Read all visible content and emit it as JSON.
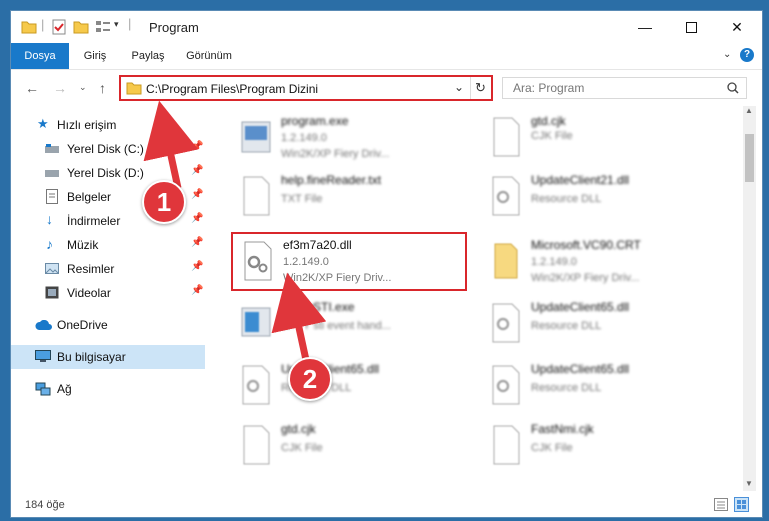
{
  "window": {
    "title": "Program"
  },
  "ribbon": {
    "tabs": [
      "Dosya",
      "Giriş",
      "Paylaş",
      "Görünüm"
    ]
  },
  "address": {
    "path": "C:\\Program Files\\Program Dizini"
  },
  "search": {
    "placeholder": "Ara: Program"
  },
  "sidebar": {
    "quick_access": "Hızlı erişim",
    "items": [
      {
        "label": "Yerel Disk (C:)"
      },
      {
        "label": "Yerel Disk (D:)"
      },
      {
        "label": "Belgeler"
      },
      {
        "label": "İndirmeler"
      },
      {
        "label": "Müzik"
      },
      {
        "label": "Resimler"
      },
      {
        "label": "Videolar"
      }
    ],
    "onedrive": "OneDrive",
    "this_pc": "Bu bilgisayar",
    "network": "Ağ"
  },
  "files": [
    {
      "name": "program.exe",
      "version": "1.2.149.0",
      "desc": "Win2K/XP Fiery Driv..."
    },
    {
      "name": "gtd.cjk",
      "version": "",
      "desc": "CJK File"
    },
    {
      "name": "help.fineReader.txt",
      "version": "",
      "desc": "TXT File"
    },
    {
      "name": "UpdateClient21.dll",
      "version": "",
      "desc": "Resource DLL"
    },
    {
      "name": "ef3m7a20.dll",
      "version": "1.2.149.0",
      "desc": "Win2K/XP Fiery Driv..."
    },
    {
      "name": "Microsoft.VC90.CRT",
      "version": "1.2.149.0",
      "desc": "Win2K/XP Fiery Driv..."
    },
    {
      "name": "babyySTI.exe",
      "version": "",
      "desc": "BABY sti event hand..."
    },
    {
      "name": "UpdateClient65.dll",
      "version": "",
      "desc": "Resource DLL"
    },
    {
      "name": "UpdateClient65.dll",
      "version": "",
      "desc": "Resource DLL"
    },
    {
      "name": "UpdateClient65.dll",
      "version": "",
      "desc": "Resource DLL"
    },
    {
      "name": "gtd.cjk",
      "version": "",
      "desc": "CJK File"
    },
    {
      "name": "FastNmi.cjk",
      "version": "",
      "desc": "CJK File"
    }
  ],
  "status": {
    "count": "184 öğe"
  },
  "annotations": {
    "one": "1",
    "two": "2"
  },
  "colors": {
    "accent": "#1979ca",
    "highlight": "#d9262b"
  }
}
